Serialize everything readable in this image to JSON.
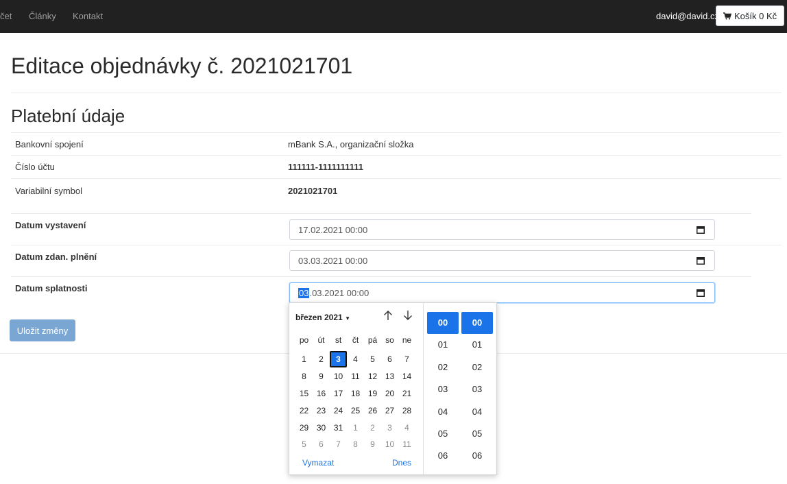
{
  "nav": {
    "links": [
      "čet",
      "Články",
      "Kontakt"
    ],
    "user": "david@david.cz",
    "cart": "Košík 0 Kč"
  },
  "page": {
    "title": "Editace objednávky č. 2021021701",
    "section_title": "Platební údaje"
  },
  "payment": {
    "rows": [
      {
        "label": "Bankovní spojení",
        "value": "mBank S.A., organizační složka",
        "bold": false
      },
      {
        "label": "Číslo účtu",
        "value": "111111-1111111111",
        "bold": true
      },
      {
        "label": "Variabilní symbol",
        "value": "2021021701",
        "bold": true
      }
    ]
  },
  "dates": {
    "issued": {
      "label": "Datum vystavení",
      "value": "17.02.2021 00:00"
    },
    "taxable": {
      "label": "Datum zdan. plnění",
      "value": "03.03.2021 00:00"
    },
    "due": {
      "label": "Datum splatnosti",
      "value_selected": "03",
      "value_rest": ".03.2021 00:00"
    }
  },
  "save_button": "Uložit změny",
  "picker": {
    "month": "březen 2021",
    "weekdays": [
      "po",
      "út",
      "st",
      "čt",
      "pá",
      "so",
      "ne"
    ],
    "weeks": [
      [
        [
          "1",
          0
        ],
        [
          "2",
          0
        ],
        [
          "3",
          0
        ],
        [
          "4",
          0
        ],
        [
          "5",
          0
        ],
        [
          "6",
          0
        ],
        [
          "7",
          0
        ]
      ],
      [
        [
          "8",
          0
        ],
        [
          "9",
          0
        ],
        [
          "10",
          0
        ],
        [
          "11",
          0
        ],
        [
          "12",
          0
        ],
        [
          "13",
          0
        ],
        [
          "14",
          0
        ]
      ],
      [
        [
          "15",
          0
        ],
        [
          "16",
          0
        ],
        [
          "17",
          0
        ],
        [
          "18",
          0
        ],
        [
          "19",
          0
        ],
        [
          "20",
          0
        ],
        [
          "21",
          0
        ]
      ],
      [
        [
          "22",
          0
        ],
        [
          "23",
          0
        ],
        [
          "24",
          0
        ],
        [
          "25",
          0
        ],
        [
          "26",
          0
        ],
        [
          "27",
          0
        ],
        [
          "28",
          0
        ]
      ],
      [
        [
          "29",
          0
        ],
        [
          "30",
          0
        ],
        [
          "31",
          0
        ],
        [
          "1",
          1
        ],
        [
          "2",
          1
        ],
        [
          "3",
          1
        ],
        [
          "4",
          1
        ]
      ],
      [
        [
          "5",
          1
        ],
        [
          "6",
          1
        ],
        [
          "7",
          1
        ],
        [
          "8",
          1
        ],
        [
          "9",
          1
        ],
        [
          "10",
          1
        ],
        [
          "11",
          1
        ]
      ]
    ],
    "selected_day": "3",
    "clear": "Vymazat",
    "today": "Dnes",
    "hours": [
      "00",
      "01",
      "02",
      "03",
      "04",
      "05",
      "06"
    ],
    "minutes": [
      "00",
      "01",
      "02",
      "03",
      "04",
      "05",
      "06"
    ],
    "selected_hour": "00",
    "selected_minute": "00"
  },
  "colors": {
    "accent": "#1a73e8",
    "navbar": "#212121",
    "save_button": "#7aa6d4"
  }
}
